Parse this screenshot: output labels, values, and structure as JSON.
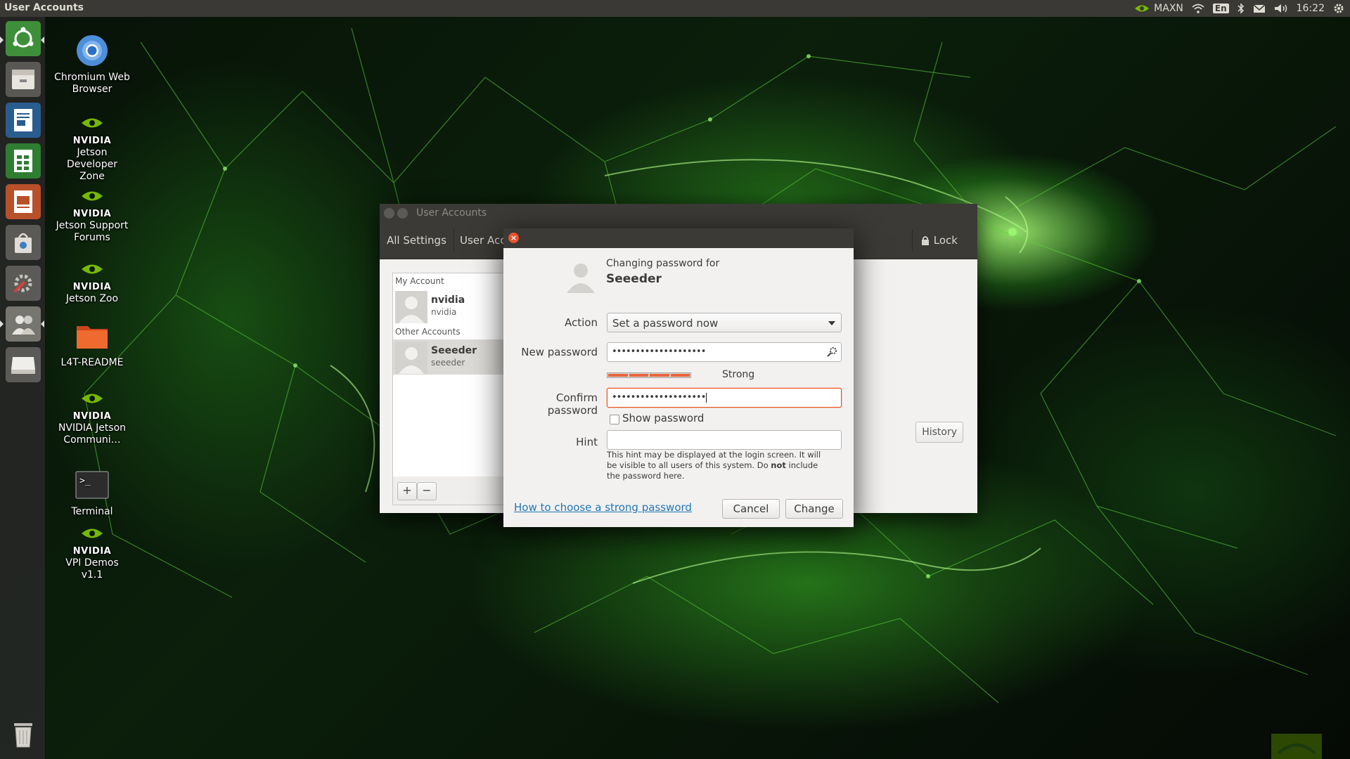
{
  "top_panel": {
    "app_title": "User Accounts",
    "power_mode": "MAXN",
    "keyboard_layout": "En",
    "clock": "16:22"
  },
  "launcher": {
    "items": [
      {
        "icon": "ubuntu-dash-icon"
      },
      {
        "icon": "files-icon"
      },
      {
        "icon": "writer-icon"
      },
      {
        "icon": "calc-icon"
      },
      {
        "icon": "impress-icon"
      },
      {
        "icon": "software-center-icon"
      },
      {
        "icon": "system-settings-icon"
      },
      {
        "icon": "user-accounts-icon"
      },
      {
        "icon": "drive-icon"
      },
      {
        "icon": "trash-icon"
      }
    ]
  },
  "desktop": {
    "icons": [
      {
        "label": "Chromium Web Browser",
        "icon": "chromium-icon"
      },
      {
        "brand": "NVIDIA",
        "label": "Jetson Developer Zone",
        "icon": "nvidia-icon"
      },
      {
        "brand": "NVIDIA",
        "label": "Jetson Support Forums",
        "icon": "nvidia-icon"
      },
      {
        "brand": "NVIDIA",
        "label": "Jetson Zoo",
        "icon": "nvidia-icon"
      },
      {
        "label": "L4T-README",
        "icon": "folder-icon"
      },
      {
        "brand": "NVIDIA",
        "label": "NVIDIA Jetson Communi…",
        "icon": "nvidia-icon"
      },
      {
        "label": "Terminal",
        "icon": "terminal-icon"
      },
      {
        "brand": "NVIDIA",
        "label": "VPI Demos v1.1",
        "icon": "nvidia-icon"
      }
    ]
  },
  "window": {
    "title": "User Accounts",
    "all_settings": "All Settings",
    "breadcrumb": "User Acco",
    "lock_label": "Lock",
    "my_account_header": "My Account",
    "other_accounts_header": "Other Accounts",
    "accounts": [
      {
        "name": "nvidia",
        "login": "nvidia"
      },
      {
        "name": "Seeeder",
        "login": "seeeder"
      }
    ],
    "add_label": "+",
    "remove_label": "−",
    "history_label": "History"
  },
  "dialog": {
    "subtitle": "Changing password for",
    "username": "Seeeder",
    "action_label": "Action",
    "action_value": "Set a password now",
    "new_password_label": "New password",
    "new_password_value": "••••••••••••••••••••",
    "strength_label": "Strong",
    "strength_level": 1.0,
    "confirm_password_label": "Confirm password",
    "confirm_password_value": "••••••••••••••••••••",
    "show_password_label": "Show password",
    "show_password_checked": false,
    "hint_label": "Hint",
    "hint_value": "",
    "hint_help_1": "This hint may be displayed at the login screen.  It will be visible to all users of this system.  Do ",
    "hint_help_bold": "not",
    "hint_help_2": " include the password here.",
    "help_link": "How to choose a strong password",
    "cancel_label": "Cancel",
    "change_label": "Change"
  },
  "colors": {
    "panel": "#3a3935",
    "accent_orange": "#e9541f",
    "close_button": "#e9532b",
    "link": "#2077b8",
    "nvidia_green": "#76b900"
  }
}
